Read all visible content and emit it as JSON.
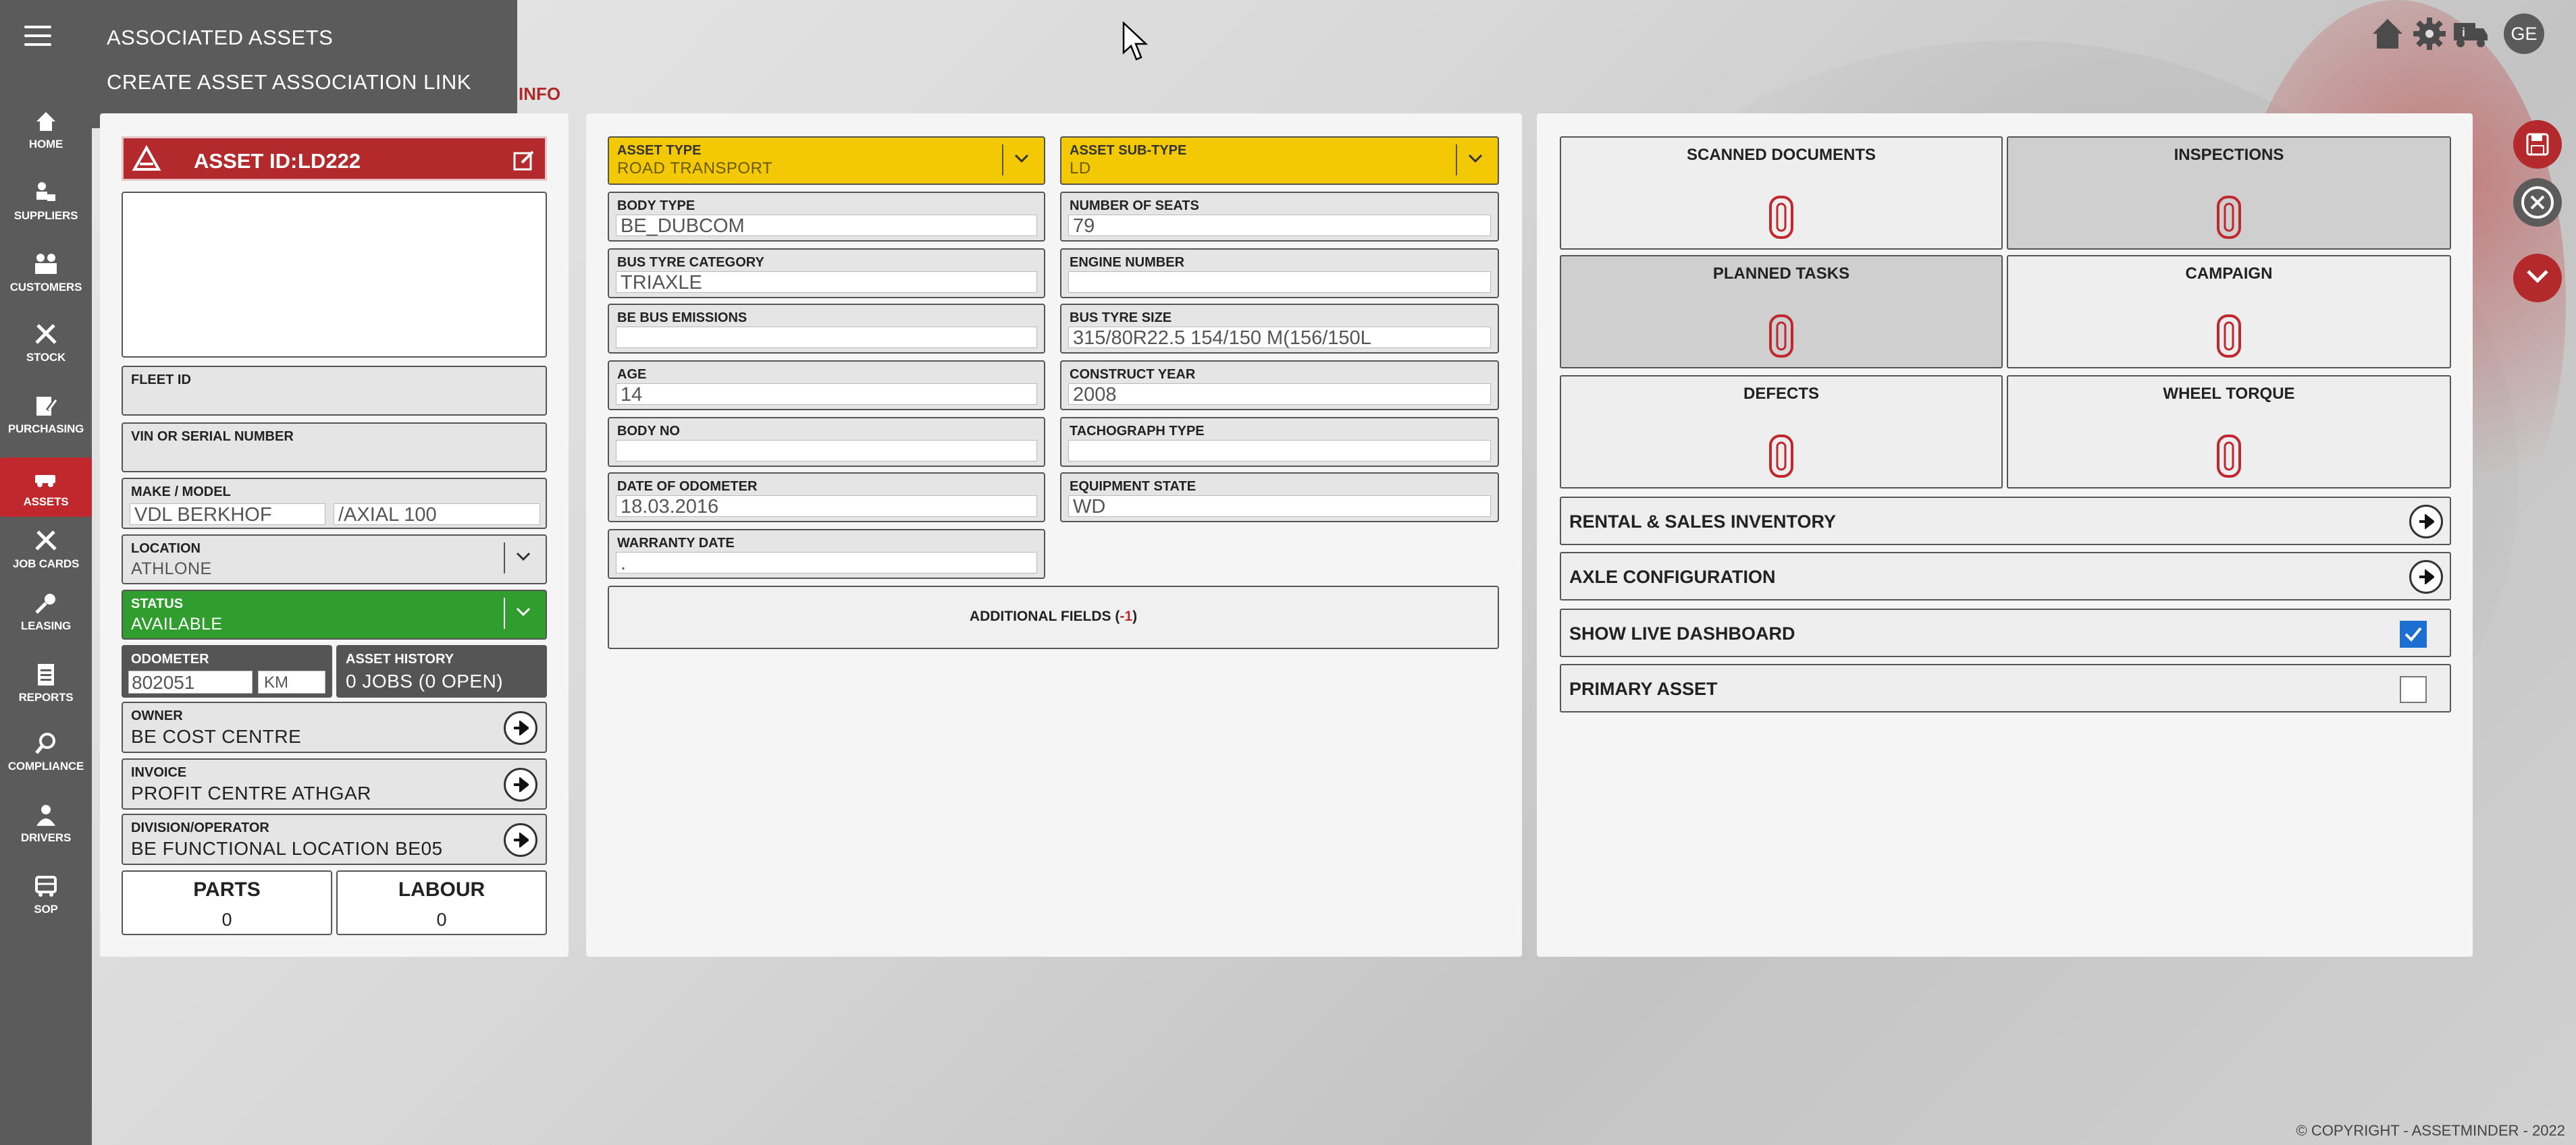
{
  "menu": {
    "items": [
      "ASSOCIATED ASSETS",
      "CREATE ASSET ASSOCIATION LINK"
    ]
  },
  "tab_partial": "INFO",
  "sidebar": {
    "items": [
      {
        "label": "HOME",
        "icon": "home-icon"
      },
      {
        "label": "SUPPLIERS",
        "icon": "suppliers-icon"
      },
      {
        "label": "CUSTOMERS",
        "icon": "customers-icon"
      },
      {
        "label": "STOCK",
        "icon": "stock-icon"
      },
      {
        "label": "PURCHASING",
        "icon": "purchasing-icon"
      },
      {
        "label": "ASSETS",
        "icon": "assets-icon",
        "active": true
      },
      {
        "label": "JOB CARDS",
        "icon": "job-cards-icon"
      },
      {
        "label": "LEASING",
        "icon": "leasing-icon"
      },
      {
        "label": "REPORTS",
        "icon": "reports-icon"
      },
      {
        "label": "COMPLIANCE",
        "icon": "compliance-icon"
      },
      {
        "label": "DRIVERS",
        "icon": "drivers-icon"
      },
      {
        "label": "SOP",
        "icon": "sop-icon"
      }
    ]
  },
  "user": {
    "initials": "GE"
  },
  "left": {
    "asset_id_label": "ASSET ID:",
    "asset_id": "LD222",
    "fleet_id": {
      "label": "FLEET ID",
      "value": ""
    },
    "vin": {
      "label": "VIN OR SERIAL NUMBER",
      "value": ""
    },
    "make_model": {
      "label": "MAKE / MODEL",
      "make": "VDL BERKHOF",
      "model": "/AXIAL 100"
    },
    "location": {
      "label": "LOCATION",
      "value": "ATHLONE"
    },
    "status": {
      "label": "STATUS",
      "value": "AVAILABLE"
    },
    "odometer": {
      "label": "ODOMETER",
      "value": "802051",
      "unit": "KM"
    },
    "asset_history": {
      "label": "ASSET HISTORY",
      "value": "0 JOBS (0 OPEN)"
    },
    "owner": {
      "label": "OWNER",
      "value": "BE COST CENTRE"
    },
    "invoice": {
      "label": "INVOICE",
      "value": "PROFIT CENTRE ATHGAR"
    },
    "division": {
      "label": "DIVISION/OPERATOR",
      "value": "BE FUNCTIONAL LOCATION BE05"
    },
    "parts": {
      "label": "PARTS",
      "value": "0"
    },
    "labour": {
      "label": "LABOUR",
      "value": "0"
    }
  },
  "middle": {
    "asset_type": {
      "label": "ASSET TYPE",
      "value": "ROAD TRANSPORT"
    },
    "asset_sub_type": {
      "label": "ASSET SUB-TYPE",
      "value": "LD"
    },
    "body_type": {
      "label": "BODY TYPE",
      "value": "BE_DUBCOM"
    },
    "number_of_seats": {
      "label": "NUMBER OF SEATS",
      "value": "79"
    },
    "bus_tyre_category": {
      "label": "BUS TYRE CATEGORY",
      "value": "TRIAXLE"
    },
    "engine_number": {
      "label": "ENGINE NUMBER",
      "value": ""
    },
    "be_bus_emissions": {
      "label": "BE BUS EMISSIONS",
      "value": ""
    },
    "bus_tyre_size": {
      "label": "BUS TYRE SIZE",
      "value": "315/80R22.5 154/150 M(156/150L"
    },
    "age": {
      "label": "AGE",
      "value": "14"
    },
    "construct_year": {
      "label": "CONSTRUCT YEAR",
      "value": "2008"
    },
    "body_no": {
      "label": "BODY NO",
      "value": ""
    },
    "tachograph_type": {
      "label": "TACHOGRAPH TYPE",
      "value": ""
    },
    "date_of_odometer": {
      "label": "DATE OF ODOMETER",
      "value": "18.03.2016"
    },
    "equipment_state": {
      "label": "EQUIPMENT STATE",
      "value": "WD"
    },
    "warranty_date": {
      "label": "WARRANTY DATE",
      "value": "."
    },
    "additional_fields": {
      "label": "ADDITIONAL FIELDS (",
      "count": "-1",
      "close": ")"
    }
  },
  "right": {
    "tiles": [
      {
        "label": "SCANNED DOCUMENTS",
        "dark": false
      },
      {
        "label": "INSPECTIONS",
        "dark": true
      },
      {
        "label": "PLANNED TASKS",
        "dark": true
      },
      {
        "label": "CAMPAIGN",
        "dark": false
      },
      {
        "label": "DEFECTS",
        "dark": false
      },
      {
        "label": "WHEEL TORQUE",
        "dark": false
      }
    ],
    "rows": [
      {
        "label": "RENTAL & SALES INVENTORY",
        "kind": "arrow"
      },
      {
        "label": "AXLE CONFIGURATION",
        "kind": "arrow"
      },
      {
        "label": "SHOW LIVE DASHBOARD",
        "kind": "checkbox",
        "checked": true
      },
      {
        "label": "PRIMARY ASSET",
        "kind": "checkbox",
        "checked": false
      }
    ]
  },
  "footer": {
    "copyright": "© COPYRIGHT - ASSETMINDER - 2022"
  },
  "colors": {
    "sidebar": "#5b5b5b",
    "accent_red": "#b42a2c",
    "yellow": "#f3c906",
    "green": "#2f9e2f",
    "checkbox_blue": "#1c6fd1"
  }
}
